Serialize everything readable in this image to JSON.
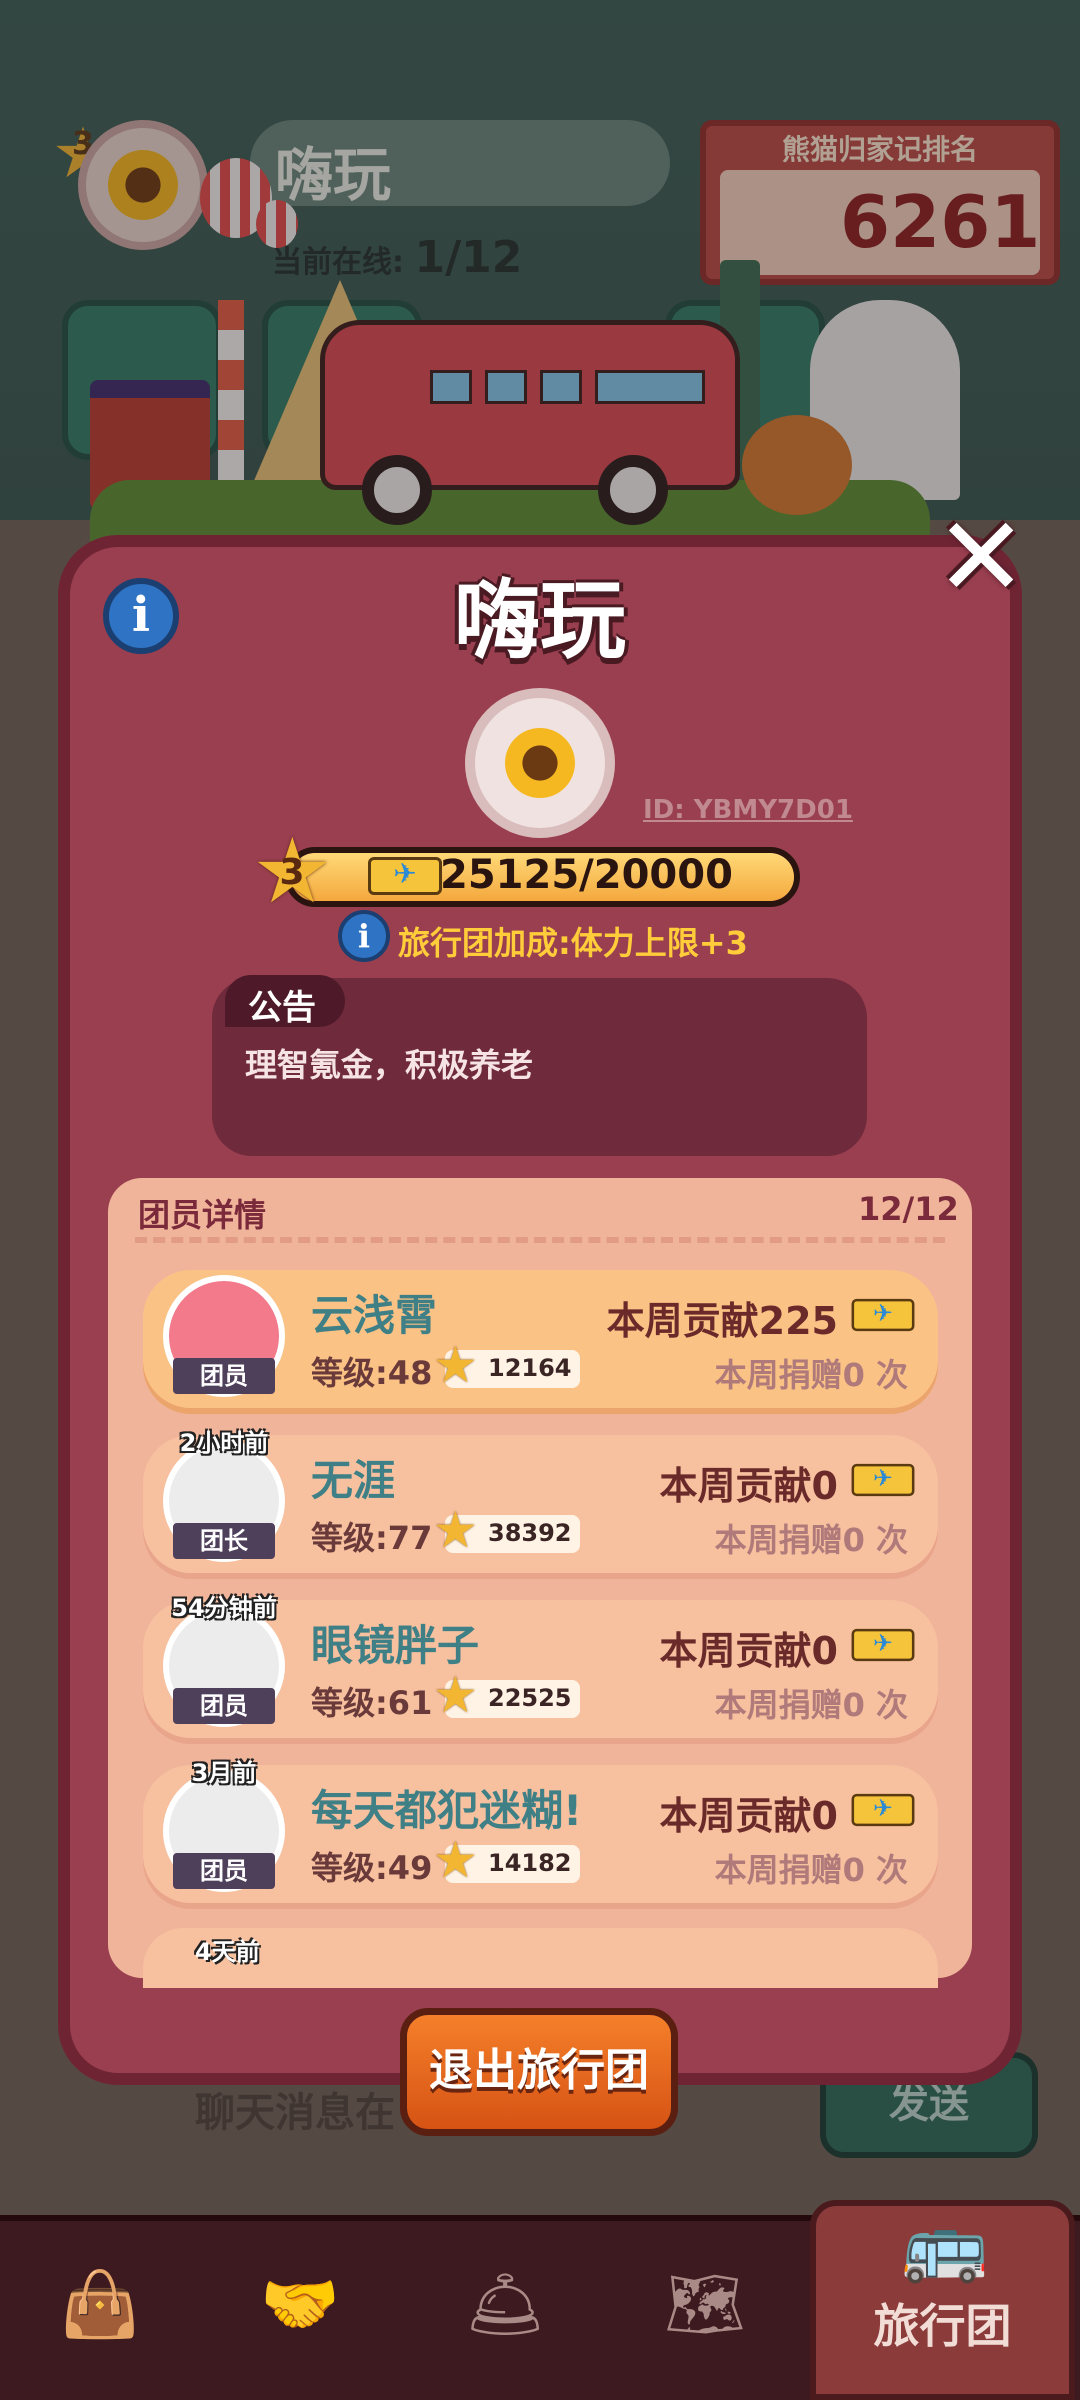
{
  "background": {
    "team_name": "嗨玩",
    "online_label": "当前在线:",
    "online_value": "1/12",
    "level": "3",
    "rank_title": "熊猫归家记排名",
    "rank_value": "6261",
    "chat_placeholder": "聊天消息在",
    "send_label": "发送"
  },
  "modal": {
    "title": "嗨玩",
    "info_icon": "i",
    "close_icon": "✕",
    "team_id": "ID: YBMY7D01",
    "level": "3",
    "progress_text": "25125/20000",
    "progress_fraction": 1.0,
    "bonus_icon": "i",
    "bonus_text": "旅行团加成:体力上限+3",
    "notice": {
      "label": "公告",
      "text": "理智氪金，积极养老"
    },
    "members": {
      "title": "团员详情",
      "count": "12/12",
      "list": [
        {
          "name": "云浅霄",
          "role": "团员",
          "level": "等级:48",
          "score": "12164",
          "contribution": "本周贡献225",
          "donation": "本周捐赠0 次",
          "last_online": ""
        },
        {
          "name": "无涯",
          "role": "团长",
          "level": "等级:77",
          "score": "38392",
          "contribution": "本周贡献0",
          "donation": "本周捐赠0 次",
          "last_online": "2小时前"
        },
        {
          "name": "眼镜胖子",
          "role": "团员",
          "level": "等级:61",
          "score": "22525",
          "contribution": "本周贡献0",
          "donation": "本周捐赠0 次",
          "last_online": "54分钟前"
        },
        {
          "name": "每天都犯迷糊!",
          "role": "团员",
          "level": "等级:49",
          "score": "14182",
          "contribution": "本周贡献0",
          "donation": "本周捐赠0 次",
          "last_online": "3月前"
        }
      ],
      "partial_last_online": "4天前"
    },
    "exit_label": "退出旅行团"
  },
  "nav": {
    "items": [
      "bag-icon",
      "handshake-icon",
      "service-bell-icon",
      "map-icon"
    ],
    "active_label": "旅行团",
    "active_icon": "bus-icon"
  }
}
